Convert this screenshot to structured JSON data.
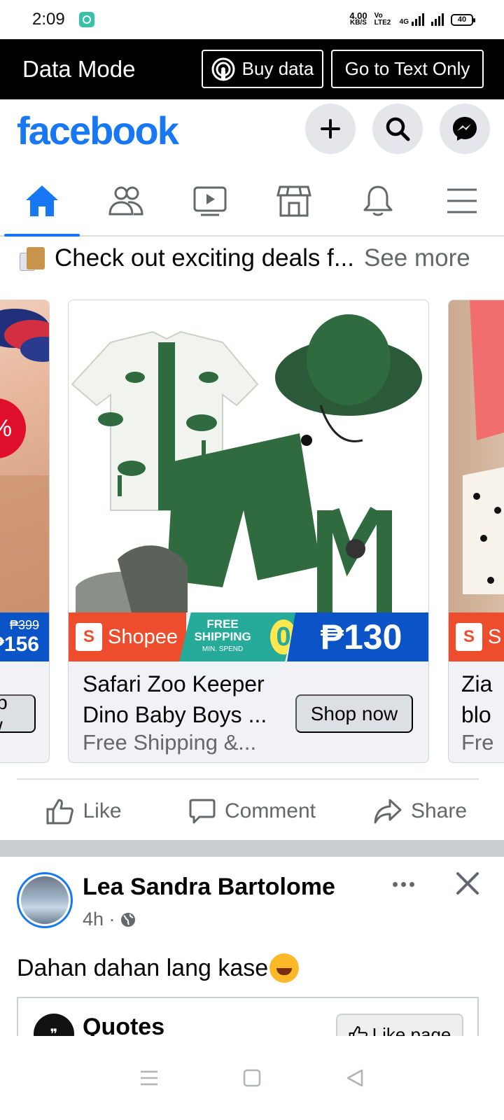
{
  "status_bar": {
    "time": "2:09",
    "net_speed_value": "4.00",
    "net_speed_unit": "KB/S",
    "volte": "Vo LTE2",
    "network": "4G",
    "battery": "40"
  },
  "data_mode": {
    "title": "Data Mode",
    "buy_data_label": "Buy data",
    "text_only_label": "Go to Text Only"
  },
  "header": {
    "logo": "facebook",
    "icons": [
      "add-icon",
      "search-icon",
      "messenger-icon"
    ]
  },
  "nav_tabs": [
    {
      "name": "home",
      "icon": "home-icon",
      "active": true
    },
    {
      "name": "friends",
      "icon": "friends-icon",
      "active": false
    },
    {
      "name": "watch",
      "icon": "video-icon",
      "active": false
    },
    {
      "name": "marketplace",
      "icon": "store-icon",
      "active": false
    },
    {
      "name": "notifications",
      "icon": "bell-icon",
      "active": false
    },
    {
      "name": "menu",
      "icon": "hamburger-icon",
      "active": false
    }
  ],
  "post": {
    "text": "Check out exciting deals f...",
    "see_more": "See more"
  },
  "carousel": {
    "left_card": {
      "old_price": "₱399",
      "new_price": "₱156",
      "discount": "%",
      "shop_now": "Shop now"
    },
    "main_card": {
      "brand": "Shopee",
      "free_shipping": "FREE SHIPPING",
      "min_spend": "MIN. SPEND",
      "min_spend_value": "0",
      "price": "₱130",
      "title_line1": "Safari Zoo Keeper",
      "title_line2": "Dino Baby Boys ...",
      "description": "Free Shipping &...",
      "shop_now": "Shop now"
    },
    "right_card": {
      "brand": "S",
      "title_line1": "Zia",
      "title_line2": "blo",
      "description": "Fre"
    }
  },
  "actions": {
    "like": "Like",
    "comment": "Comment",
    "share": "Share"
  },
  "second_post": {
    "author": "Lea Sandra Bartolome",
    "time": "4h ·",
    "text": "Dahan dahan lang kase",
    "shared_page": "Quotes",
    "like_page": "Like page"
  },
  "colors": {
    "facebook_blue": "#1877f2",
    "shopee_orange": "#ee4d2d",
    "shipping_teal": "#26aa99",
    "price_blue": "#0a54c8"
  }
}
